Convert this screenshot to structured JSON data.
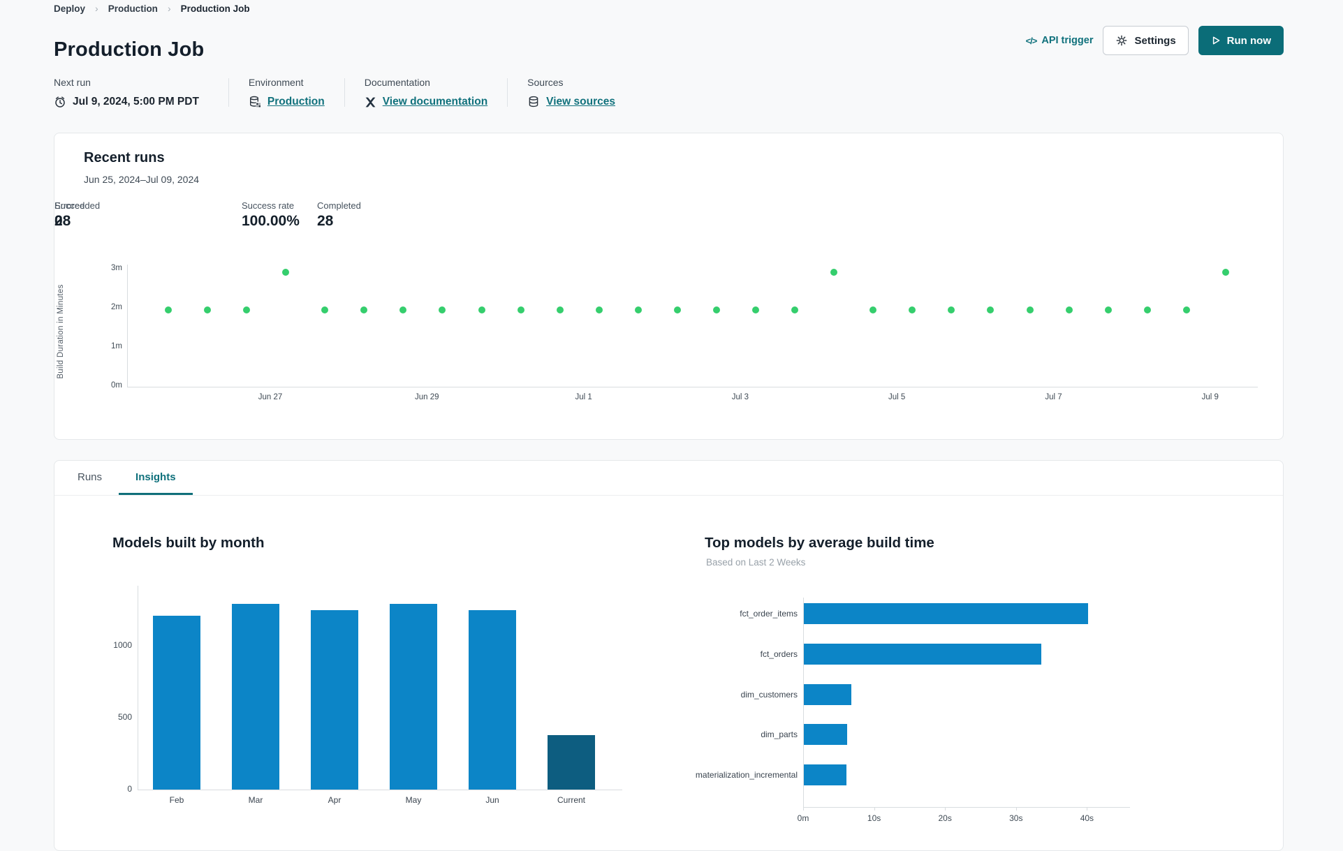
{
  "breadcrumb": {
    "items": [
      "Deploy",
      "Production",
      "Production Job"
    ]
  },
  "header": {
    "title": "Production Job",
    "api_trigger_label": "API trigger",
    "settings_label": "Settings",
    "run_now_label": "Run now"
  },
  "meta": {
    "next_run": {
      "label": "Next run",
      "value": "Jul 9, 2024, 5:00 PM PDT"
    },
    "environment": {
      "label": "Environment",
      "value": "Production"
    },
    "documentation": {
      "label": "Documentation",
      "value": "View documentation"
    },
    "sources": {
      "label": "Sources",
      "value": "View sources"
    }
  },
  "recent_runs": {
    "title": "Recent runs",
    "date_range": "Jun 25, 2024–Jul 09, 2024",
    "stats": [
      {
        "label": "Success rate",
        "value": "100.00%"
      },
      {
        "label": "Completed",
        "value": "28"
      },
      {
        "label": "Succeeded",
        "value": "28"
      },
      {
        "label": "Errored",
        "value": "0"
      }
    ]
  },
  "tabs": [
    {
      "label": "Runs",
      "active": false
    },
    {
      "label": "Insights",
      "active": true
    }
  ],
  "colors": {
    "accent_teal": "#10717c",
    "run_now_bg": "#0b6d78",
    "bar_blue": "#0c85c7",
    "bar_current_dark": "#0d5d80",
    "dot_green": "#35ce6d",
    "axis_gray": "#d8dcdf"
  },
  "chart_data": [
    {
      "id": "build-duration-scatter",
      "type": "scatter",
      "ylabel": "Build Duration in Minutes",
      "yticks": [
        "0m",
        "1m",
        "2m",
        "3m"
      ],
      "ylim": [
        0,
        3.2
      ],
      "xticklabels": [
        "Jun 27",
        "Jun 29",
        "Jul 1",
        "Jul 3",
        "Jul 5",
        "Jul 7",
        "Jul 9"
      ],
      "point_color": "#35ce6d",
      "points_minutes": [
        1.97,
        1.97,
        1.97,
        2.93,
        1.97,
        1.97,
        1.97,
        1.97,
        1.97,
        1.97,
        1.97,
        1.97,
        1.97,
        1.97,
        1.97,
        1.97,
        1.97,
        2.93,
        1.97,
        1.97,
        1.97,
        1.97,
        1.97,
        1.97,
        1.97,
        1.97,
        1.97,
        2.93
      ]
    },
    {
      "id": "models-built-by-month",
      "type": "bar",
      "title": "Models built by month",
      "categories": [
        "Feb",
        "Mar",
        "Apr",
        "May",
        "Jun",
        "Current"
      ],
      "values": [
        1210,
        1290,
        1250,
        1290,
        1250,
        380
      ],
      "yticks": [
        0,
        500,
        1000
      ],
      "ylim": [
        0,
        1420
      ],
      "bar_color": "#0c85c7",
      "highlight_category": "Current",
      "highlight_color": "#0d5d80"
    },
    {
      "id": "top-models-by-average-build-time",
      "type": "bar-horizontal",
      "title": "Top models by average build time",
      "subtitle": "Based on Last 2 Weeks",
      "categories": [
        "fct_order_items",
        "fct_orders",
        "dim_customers",
        "dim_parts",
        "materialization_incremental"
      ],
      "values": [
        40.1,
        33.5,
        6.7,
        6.1,
        6.0
      ],
      "unit": "seconds",
      "xticks": [
        "0m",
        "10s",
        "20s",
        "30s",
        "40s"
      ],
      "xlim": [
        0,
        43
      ],
      "bar_color": "#0c85c7"
    }
  ]
}
